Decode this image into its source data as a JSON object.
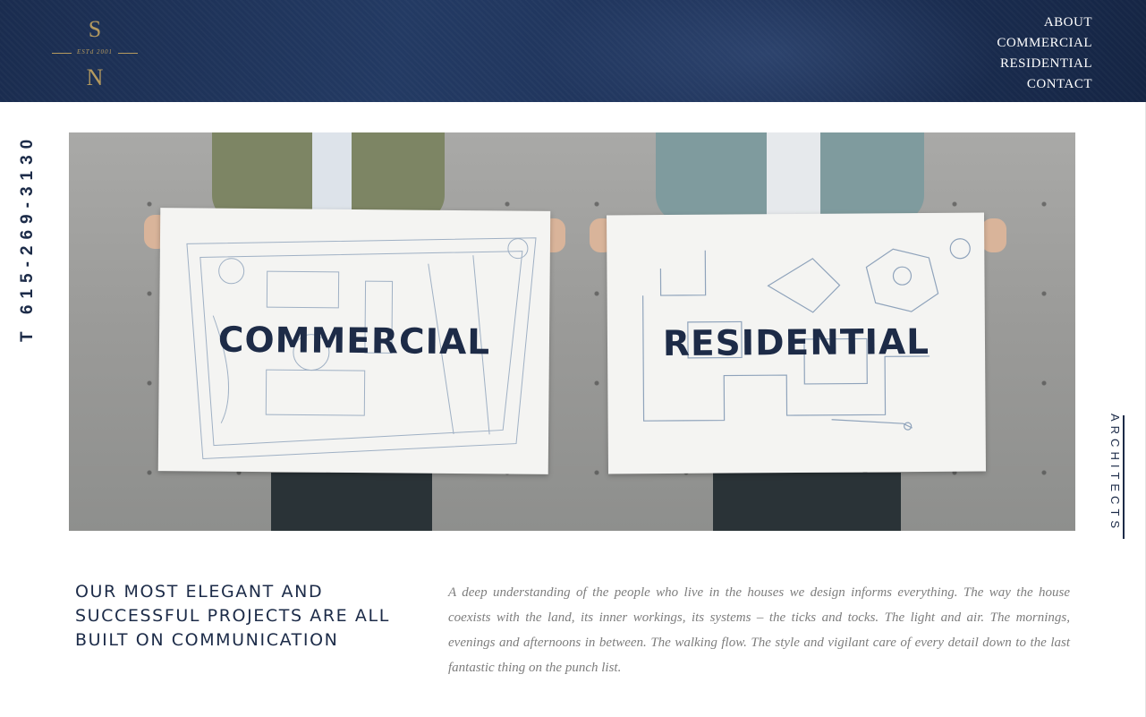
{
  "logo": {
    "top_letter": "S",
    "est": "ESTd 2001",
    "bottom_letter": "N"
  },
  "nav": {
    "items": [
      "ABOUT",
      "COMMERCIAL",
      "RESIDENTIAL",
      "CONTACT"
    ]
  },
  "side": {
    "phone": "T 615-269-3130",
    "architects": "ARCHITECTS"
  },
  "hero": {
    "commercial_label": "COMMERCIAL",
    "residential_label": "RESIDENTIAL"
  },
  "content": {
    "headline": "OUR MOST ELEGANT AND SUCCESSFUL PROJECTS ARE ALL BUILT ON COMMUNICATION",
    "body": "A deep understanding of the people who live in the houses we design informs everything. The way the house coexists with the land, its inner workings, its systems – the ticks and tocks. The light and air. The mornings, evenings and afternoons in between. The walking flow. The style and vigilant care of every detail down to the last fantastic thing on the punch list."
  },
  "colors": {
    "navy": "#1c2b48",
    "gold": "#b59a5f",
    "header_bg": "#1e3259"
  }
}
